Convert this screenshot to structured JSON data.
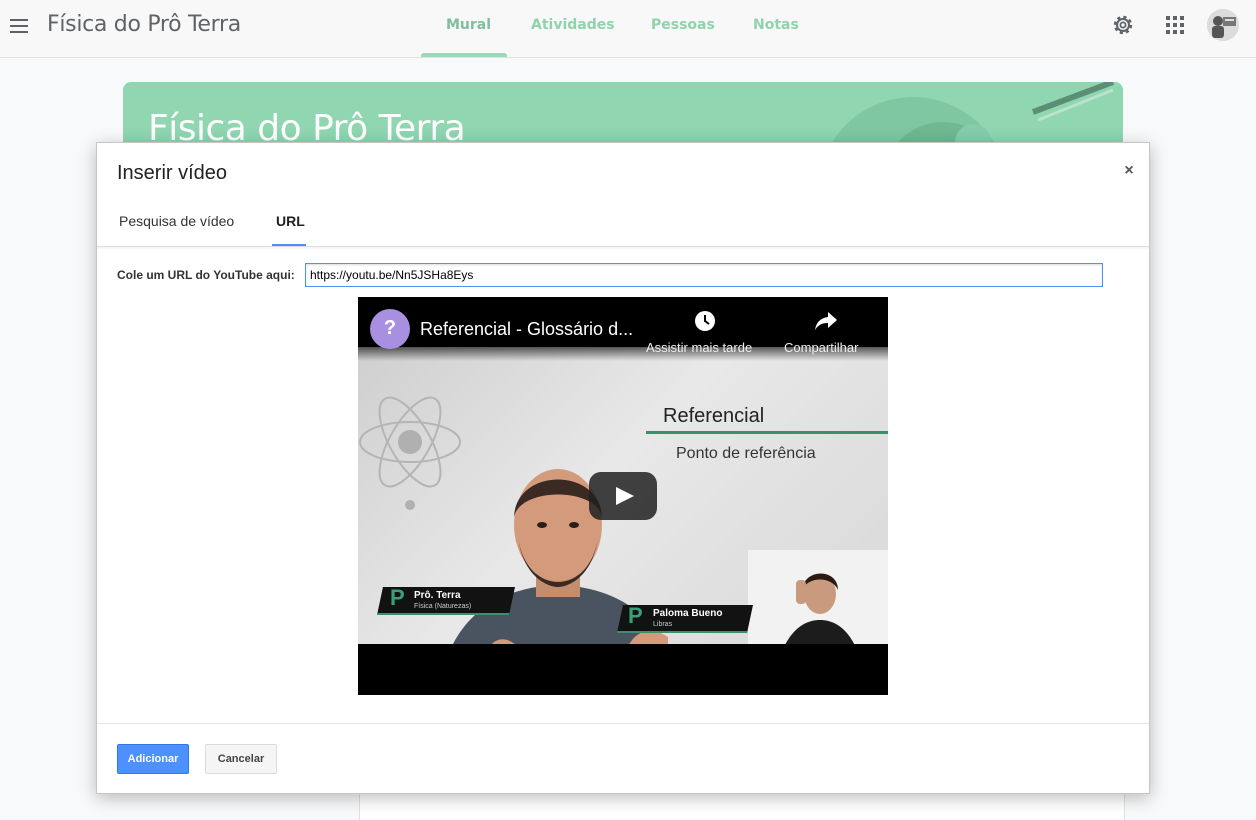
{
  "header": {
    "class_title": "Física do Prô Terra",
    "tabs": [
      {
        "label": "Mural",
        "active": true
      },
      {
        "label": "Atividades",
        "active": false
      },
      {
        "label": "Pessoas",
        "active": false
      },
      {
        "label": "Notas",
        "active": false
      }
    ],
    "icons": {
      "menu": "menu-icon",
      "settings": "gear-icon",
      "apps": "apps-grid-icon",
      "account": "avatar"
    }
  },
  "banner": {
    "title": "Física do Prô Terra",
    "color": "#8fd6b1"
  },
  "dialog": {
    "title": "Inserir vídeo",
    "close_label": "×",
    "tabs": [
      {
        "label": "Pesquisa de vídeo",
        "active": false
      },
      {
        "label": "URL",
        "active": true
      }
    ],
    "url_label": "Cole um URL do YouTube aqui:",
    "url_value": "https://youtu.be/Nn5JSHa8Eys",
    "video": {
      "title": "Referencial - Glossário d...",
      "channel_logo_letter": "?",
      "watch_later_label": "Assistir mais tarde",
      "share_label": "Compartilhar",
      "slide_heading": "Referencial",
      "slide_subtitle": "Ponto de referência",
      "presenter_name": "Prô. Terra",
      "presenter_role": "Física (Naturezas)",
      "interpreter_name": "Paloma Bueno",
      "interpreter_role": "Libras"
    },
    "buttons": {
      "add": "Adicionar",
      "cancel": "Cancelar"
    },
    "accent": "#4d90fe"
  }
}
